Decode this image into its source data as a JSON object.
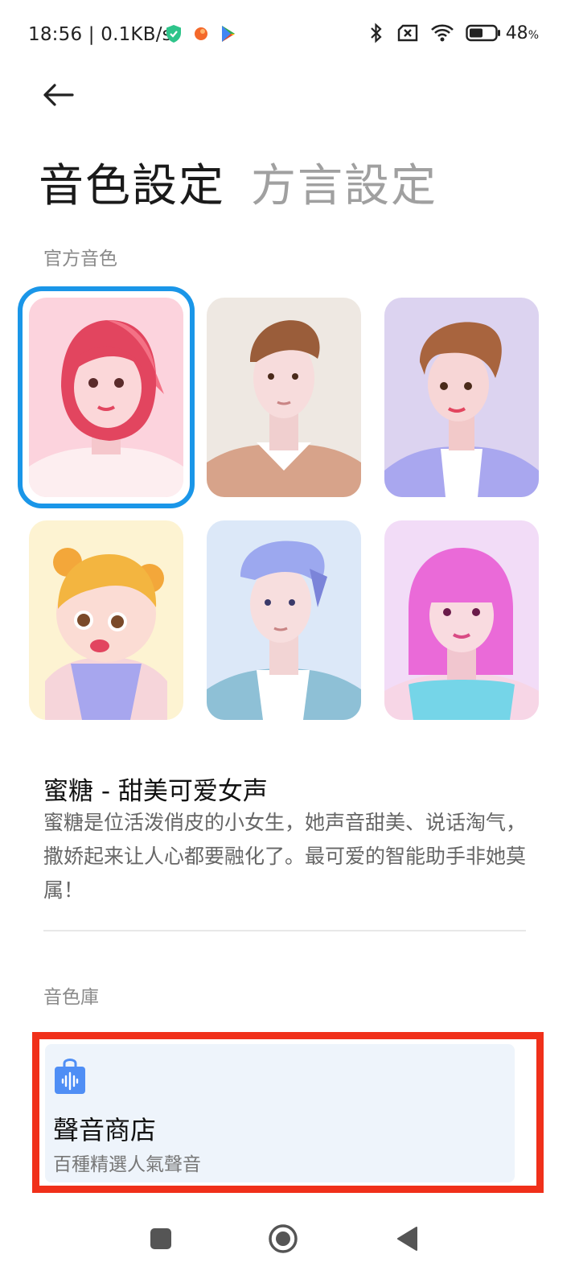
{
  "status_bar": {
    "time": "18:56 | 0.1KB/s",
    "battery": "48",
    "battery_unit": "%"
  },
  "tabs": [
    {
      "label": "音色設定",
      "active": true
    },
    {
      "label": "方言設定",
      "active": false
    }
  ],
  "official_section": {
    "label": "官方音色",
    "avatars": [
      {
        "name": "avatar-sweet-girl",
        "bg": "#fcd3dd",
        "selected": true
      },
      {
        "name": "avatar-young-man",
        "bg": "#eee8e2",
        "selected": false
      },
      {
        "name": "avatar-short-hair-woman",
        "bg": "#dcd3f0",
        "selected": false
      },
      {
        "name": "avatar-child",
        "bg": "#fdf3d2",
        "selected": false
      },
      {
        "name": "avatar-blue-hair-man",
        "bg": "#dce8f8",
        "selected": false
      },
      {
        "name": "avatar-pink-hair-woman",
        "bg": "#f2dcf7",
        "selected": false
      }
    ]
  },
  "selected_voice": {
    "title": "蜜糖 - 甜美可爱女声",
    "description": "蜜糖是位活泼俏皮的小女生，她声音甜美、说话淘气，撒娇起来让人心都要融化了。最可爱的智能助手非她莫属！"
  },
  "library_section": {
    "label": "音色庫"
  },
  "store": {
    "title": "聲音商店",
    "subtitle": "百種精選人氣聲音",
    "icon": "shopping-bag-sound-icon"
  },
  "colors": {
    "accent": "#1a96e8",
    "highlight": "#f0301a",
    "store_icon": "#4f8ef5"
  }
}
